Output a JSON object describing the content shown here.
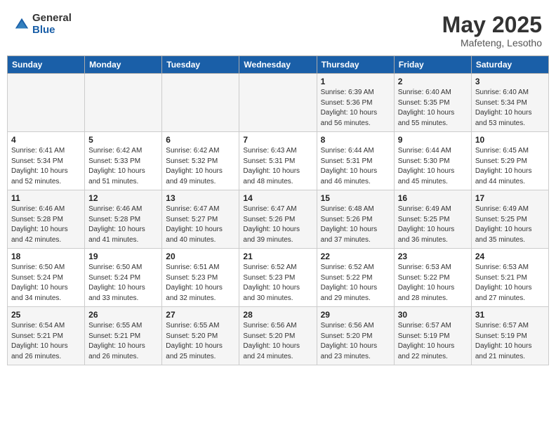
{
  "logo": {
    "general": "General",
    "blue": "Blue"
  },
  "title": "May 2025",
  "subtitle": "Mafeteng, Lesotho",
  "days_of_week": [
    "Sunday",
    "Monday",
    "Tuesday",
    "Wednesday",
    "Thursday",
    "Friday",
    "Saturday"
  ],
  "weeks": [
    [
      {
        "day": "",
        "info": ""
      },
      {
        "day": "",
        "info": ""
      },
      {
        "day": "",
        "info": ""
      },
      {
        "day": "",
        "info": ""
      },
      {
        "day": "1",
        "info": "Sunrise: 6:39 AM\nSunset: 5:36 PM\nDaylight: 10 hours\nand 56 minutes."
      },
      {
        "day": "2",
        "info": "Sunrise: 6:40 AM\nSunset: 5:35 PM\nDaylight: 10 hours\nand 55 minutes."
      },
      {
        "day": "3",
        "info": "Sunrise: 6:40 AM\nSunset: 5:34 PM\nDaylight: 10 hours\nand 53 minutes."
      }
    ],
    [
      {
        "day": "4",
        "info": "Sunrise: 6:41 AM\nSunset: 5:34 PM\nDaylight: 10 hours\nand 52 minutes."
      },
      {
        "day": "5",
        "info": "Sunrise: 6:42 AM\nSunset: 5:33 PM\nDaylight: 10 hours\nand 51 minutes."
      },
      {
        "day": "6",
        "info": "Sunrise: 6:42 AM\nSunset: 5:32 PM\nDaylight: 10 hours\nand 49 minutes."
      },
      {
        "day": "7",
        "info": "Sunrise: 6:43 AM\nSunset: 5:31 PM\nDaylight: 10 hours\nand 48 minutes."
      },
      {
        "day": "8",
        "info": "Sunrise: 6:44 AM\nSunset: 5:31 PM\nDaylight: 10 hours\nand 46 minutes."
      },
      {
        "day": "9",
        "info": "Sunrise: 6:44 AM\nSunset: 5:30 PM\nDaylight: 10 hours\nand 45 minutes."
      },
      {
        "day": "10",
        "info": "Sunrise: 6:45 AM\nSunset: 5:29 PM\nDaylight: 10 hours\nand 44 minutes."
      }
    ],
    [
      {
        "day": "11",
        "info": "Sunrise: 6:46 AM\nSunset: 5:28 PM\nDaylight: 10 hours\nand 42 minutes."
      },
      {
        "day": "12",
        "info": "Sunrise: 6:46 AM\nSunset: 5:28 PM\nDaylight: 10 hours\nand 41 minutes."
      },
      {
        "day": "13",
        "info": "Sunrise: 6:47 AM\nSunset: 5:27 PM\nDaylight: 10 hours\nand 40 minutes."
      },
      {
        "day": "14",
        "info": "Sunrise: 6:47 AM\nSunset: 5:26 PM\nDaylight: 10 hours\nand 39 minutes."
      },
      {
        "day": "15",
        "info": "Sunrise: 6:48 AM\nSunset: 5:26 PM\nDaylight: 10 hours\nand 37 minutes."
      },
      {
        "day": "16",
        "info": "Sunrise: 6:49 AM\nSunset: 5:25 PM\nDaylight: 10 hours\nand 36 minutes."
      },
      {
        "day": "17",
        "info": "Sunrise: 6:49 AM\nSunset: 5:25 PM\nDaylight: 10 hours\nand 35 minutes."
      }
    ],
    [
      {
        "day": "18",
        "info": "Sunrise: 6:50 AM\nSunset: 5:24 PM\nDaylight: 10 hours\nand 34 minutes."
      },
      {
        "day": "19",
        "info": "Sunrise: 6:50 AM\nSunset: 5:24 PM\nDaylight: 10 hours\nand 33 minutes."
      },
      {
        "day": "20",
        "info": "Sunrise: 6:51 AM\nSunset: 5:23 PM\nDaylight: 10 hours\nand 32 minutes."
      },
      {
        "day": "21",
        "info": "Sunrise: 6:52 AM\nSunset: 5:23 PM\nDaylight: 10 hours\nand 30 minutes."
      },
      {
        "day": "22",
        "info": "Sunrise: 6:52 AM\nSunset: 5:22 PM\nDaylight: 10 hours\nand 29 minutes."
      },
      {
        "day": "23",
        "info": "Sunrise: 6:53 AM\nSunset: 5:22 PM\nDaylight: 10 hours\nand 28 minutes."
      },
      {
        "day": "24",
        "info": "Sunrise: 6:53 AM\nSunset: 5:21 PM\nDaylight: 10 hours\nand 27 minutes."
      }
    ],
    [
      {
        "day": "25",
        "info": "Sunrise: 6:54 AM\nSunset: 5:21 PM\nDaylight: 10 hours\nand 26 minutes."
      },
      {
        "day": "26",
        "info": "Sunrise: 6:55 AM\nSunset: 5:21 PM\nDaylight: 10 hours\nand 26 minutes."
      },
      {
        "day": "27",
        "info": "Sunrise: 6:55 AM\nSunset: 5:20 PM\nDaylight: 10 hours\nand 25 minutes."
      },
      {
        "day": "28",
        "info": "Sunrise: 6:56 AM\nSunset: 5:20 PM\nDaylight: 10 hours\nand 24 minutes."
      },
      {
        "day": "29",
        "info": "Sunrise: 6:56 AM\nSunset: 5:20 PM\nDaylight: 10 hours\nand 23 minutes."
      },
      {
        "day": "30",
        "info": "Sunrise: 6:57 AM\nSunset: 5:19 PM\nDaylight: 10 hours\nand 22 minutes."
      },
      {
        "day": "31",
        "info": "Sunrise: 6:57 AM\nSunset: 5:19 PM\nDaylight: 10 hours\nand 21 minutes."
      }
    ]
  ]
}
